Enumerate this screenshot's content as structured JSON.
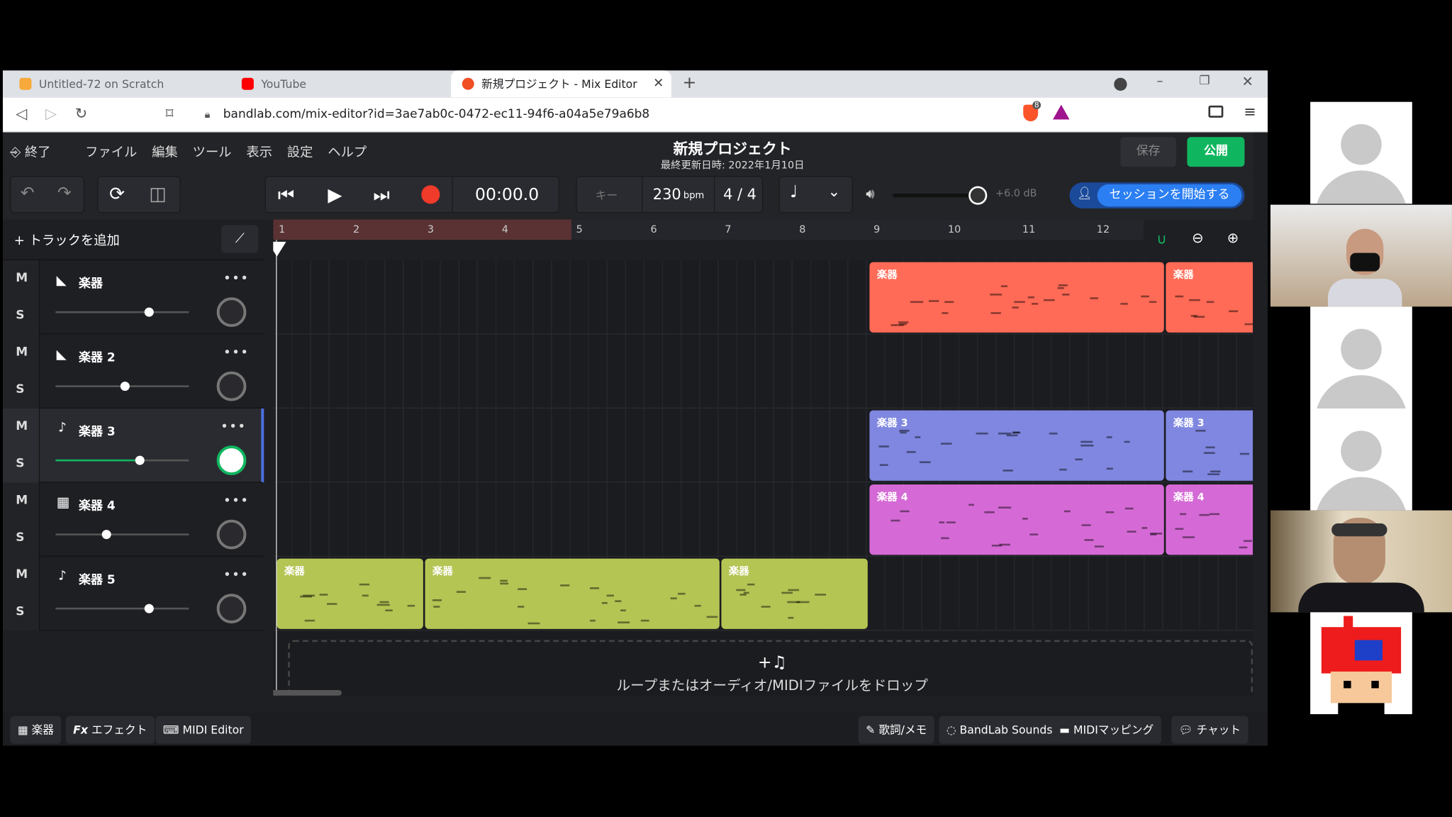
{
  "browser": {
    "tabs": [
      {
        "title": "Untitled-72 on Scratch",
        "favicon_color": "#f7a93b"
      },
      {
        "title": "YouTube",
        "favicon_color": "#ff0000"
      },
      {
        "title": "新規プロジェクト - Mix Editor",
        "favicon_color": "#f04e23"
      }
    ],
    "new_tab": "+",
    "url": "bandlab.com/mix-editor?id=3ae7ab0c-0472-ec11-94f6-a04a5e79a6b8",
    "shield_count": "8"
  },
  "app": {
    "exit_label": "終了",
    "menus": [
      "ファイル",
      "編集",
      "ツール",
      "表示",
      "設定",
      "ヘルプ"
    ],
    "project_title": "新規プロジェクト",
    "last_updated": "最終更新日時: 2022年1月10日",
    "save_label": "保存",
    "publish_label": "公開",
    "time": "00:00.0",
    "key_label": "キー",
    "bpm_value": "230",
    "bpm_unit": "bpm",
    "time_signature": "4 / 4",
    "volume_db": "+6.0 dB",
    "session_label": "セッションを開始する",
    "add_track_label": "トラックを追加",
    "ruler": [
      "1",
      "2",
      "3",
      "4",
      "5",
      "6",
      "7",
      "8",
      "9",
      "10",
      "11",
      "12"
    ],
    "tracks": [
      {
        "name": "楽器",
        "mute": "M",
        "solo": "S",
        "volume": 0.7
      },
      {
        "name": "楽器 2",
        "mute": "M",
        "solo": "S",
        "volume": 0.52
      },
      {
        "name": "楽器 3",
        "mute": "M",
        "solo": "S",
        "volume": 0.63
      },
      {
        "name": "楽器 4",
        "mute": "M",
        "solo": "S",
        "volume": 0.38
      },
      {
        "name": "楽器 5",
        "mute": "M",
        "solo": "S",
        "volume": 0.7
      }
    ],
    "clips": {
      "track1": [
        "楽器",
        "楽器"
      ],
      "track3": [
        "楽器 3",
        "楽器 3"
      ],
      "track4": [
        "楽器 4",
        "楽器 4"
      ],
      "track5": [
        "楽器",
        "楽器",
        "楽器"
      ]
    },
    "drop_hint_icon": "+♫",
    "drop_hint": "ループまたはオーディオ/MIDIファイルをドロップ",
    "bottom_left": [
      "楽器",
      "エフェクト",
      "MIDI Editor"
    ],
    "fx_prefix": "Fx",
    "bottom_right": [
      "歌詞/メモ",
      "BandLab Sounds",
      "MIDIマッピング",
      "チャット"
    ],
    "colors": {
      "red": "#ff6b57",
      "blue": "#7f87e0",
      "pink": "#d56ad6",
      "green": "#b5c554",
      "publish": "#10b65f",
      "session": "#2b7ff2"
    }
  }
}
